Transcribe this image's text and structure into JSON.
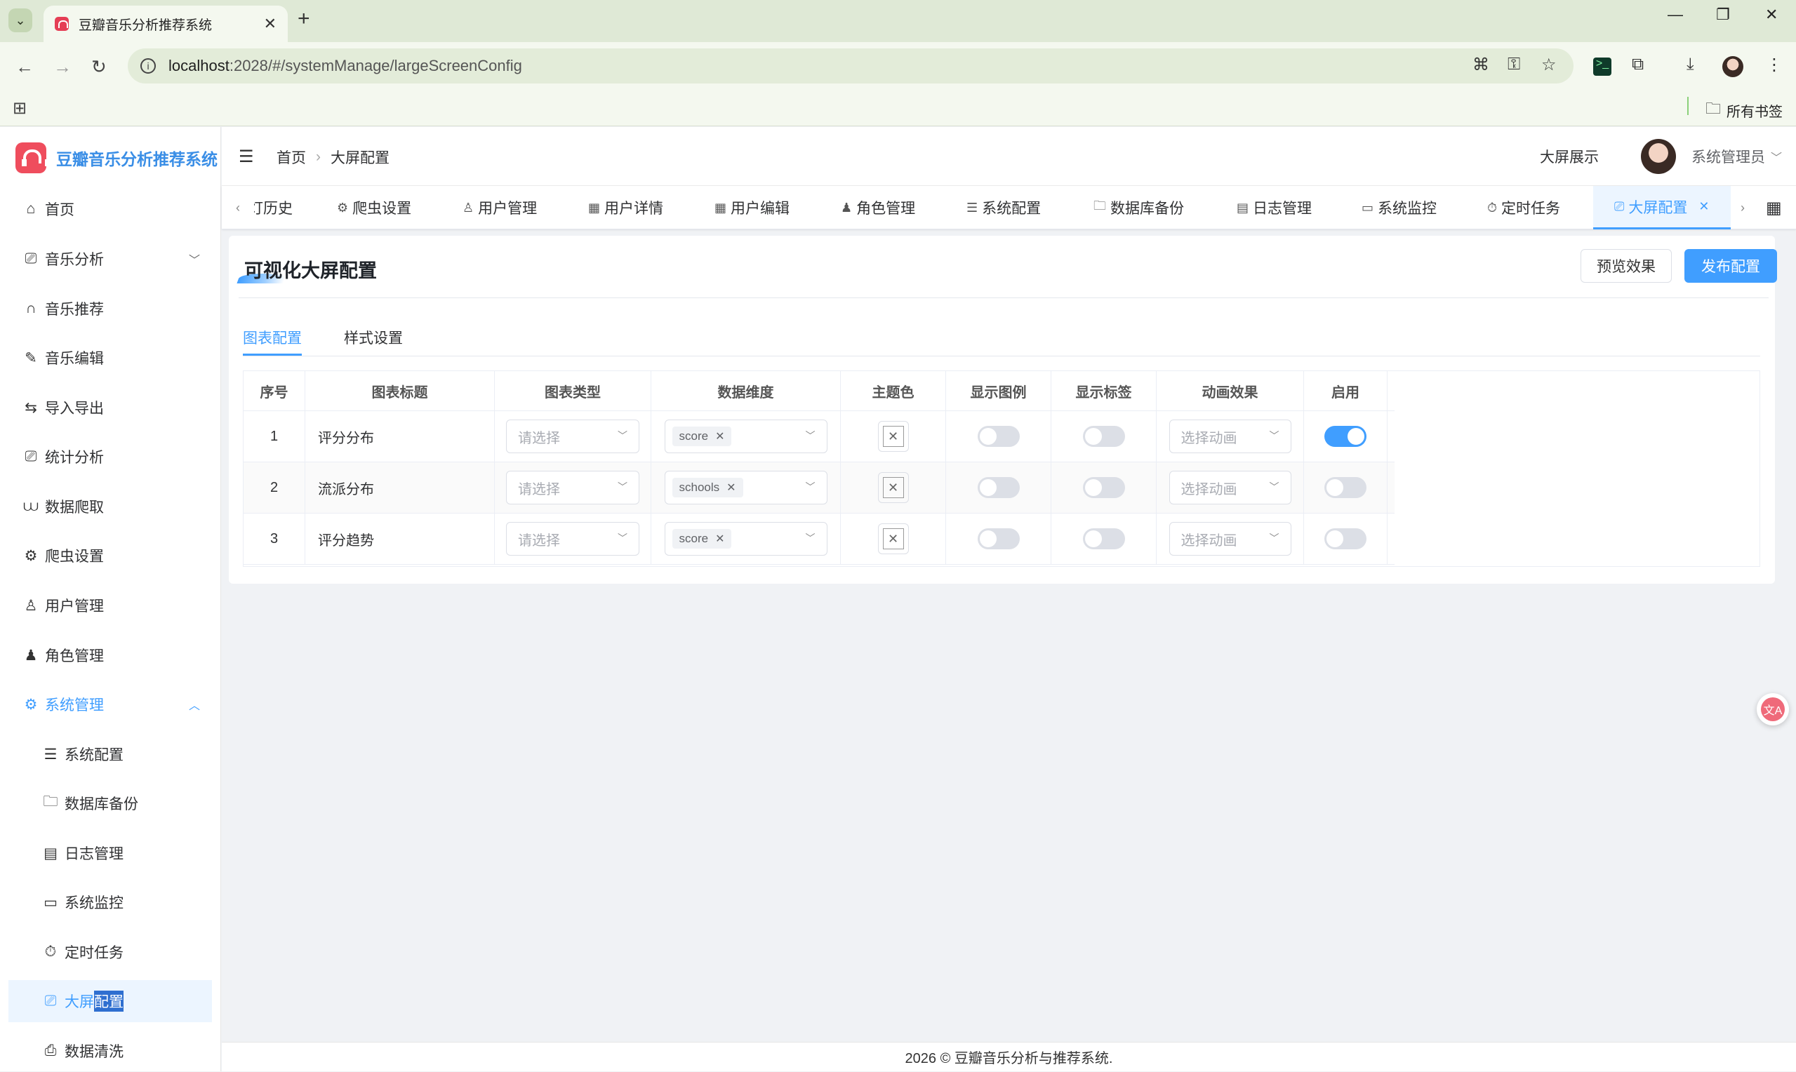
{
  "browser": {
    "tab_title": "豆瓣音乐分析推荐系统",
    "url_host": "localhost",
    "url_rest": ":2028/#/systemManage/largeScreenConfig",
    "bookmarks_label": "所有书签"
  },
  "app": {
    "logo_text": "豆瓣音乐分析推荐系统"
  },
  "sidebar": {
    "items": [
      {
        "label": "首页"
      },
      {
        "label": "音乐分析"
      },
      {
        "label": "音乐推荐"
      },
      {
        "label": "音乐编辑"
      },
      {
        "label": "导入导出"
      },
      {
        "label": "统计分析"
      },
      {
        "label": "数据爬取"
      },
      {
        "label": "爬虫设置"
      },
      {
        "label": "用户管理"
      },
      {
        "label": "角色管理"
      },
      {
        "label": "系统管理"
      }
    ],
    "sub_items": [
      {
        "label": "系统配置"
      },
      {
        "label": "数据库备份"
      },
      {
        "label": "日志管理"
      },
      {
        "label": "系统监控"
      },
      {
        "label": "定时任务"
      },
      {
        "label_a": "大屏",
        "label_b": "配置"
      },
      {
        "label": "数据清洗"
      }
    ]
  },
  "header": {
    "breadcrumb_home": "首页",
    "breadcrumb_current": "大屏配置",
    "big_screen_link": "大屏展示",
    "user_name": "系统管理员"
  },
  "tags": [
    {
      "label": "灯历史"
    },
    {
      "label": "爬虫设置"
    },
    {
      "label": "用户管理"
    },
    {
      "label": "用户详情"
    },
    {
      "label": "用户编辑"
    },
    {
      "label": "角色管理"
    },
    {
      "label": "系统配置"
    },
    {
      "label": "数据库备份"
    },
    {
      "label": "日志管理"
    },
    {
      "label": "系统监控"
    },
    {
      "label": "定时任务"
    },
    {
      "label": "大屏配置"
    }
  ],
  "page": {
    "title": "可视化大屏配置",
    "preview_button": "预览效果",
    "publish_button": "发布配置",
    "tabs": [
      "图表配置",
      "样式设置"
    ]
  },
  "table": {
    "headers": [
      "序号",
      "图表标题",
      "图表类型",
      "数据维度",
      "主题色",
      "显示图例",
      "显示标签",
      "动画效果",
      "启用"
    ],
    "type_placeholder": "请选择",
    "anim_placeholder": "选择动画",
    "rows": [
      {
        "index": "1",
        "title": "评分分布",
        "dimension": "score",
        "legend": false,
        "labels": false,
        "enabled": true
      },
      {
        "index": "2",
        "title": "流派分布",
        "dimension": "schools",
        "legend": false,
        "labels": false,
        "enabled": false
      },
      {
        "index": "3",
        "title": "评分趋势",
        "dimension": "score",
        "legend": false,
        "labels": false,
        "enabled": false
      }
    ]
  },
  "footer": {
    "text": "2026 © 豆瓣音乐分析与推荐系统."
  },
  "colors": {
    "primary": "#409eff",
    "logo": "#ef4d5d",
    "browser_chrome": "#dfe9d6"
  }
}
